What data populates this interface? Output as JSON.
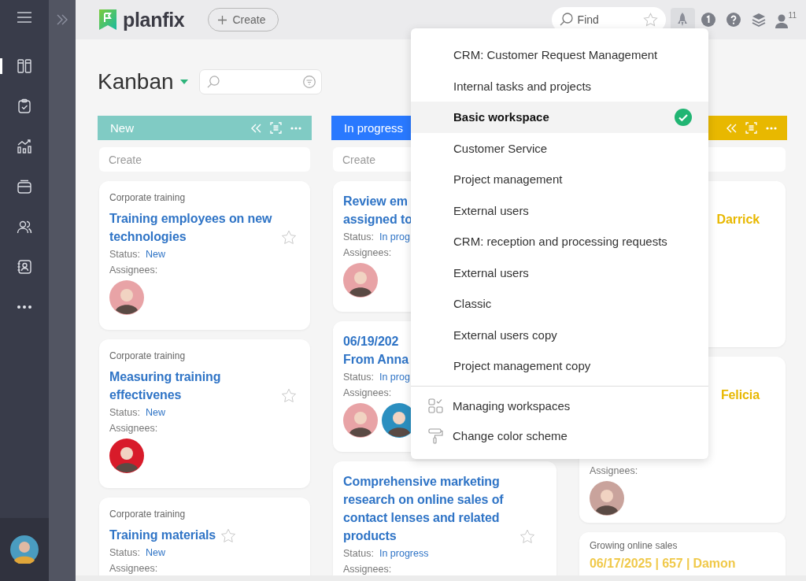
{
  "nav": [
    {
      "kind": "boards",
      "selected": true
    },
    {
      "kind": "tasks",
      "selected": false
    },
    {
      "kind": "reports",
      "selected": false
    },
    {
      "kind": "inbox",
      "selected": false
    },
    {
      "kind": "people",
      "selected": false
    },
    {
      "kind": "contact",
      "selected": false
    },
    {
      "kind": "more",
      "selected": false
    }
  ],
  "top_bar": {
    "logo": "planfix",
    "create": "Create",
    "search": {
      "placeholder": "Find"
    },
    "users_count": "11"
  },
  "page": {
    "title": "Kanban"
  },
  "columns": [
    {
      "title": "New",
      "color": "#80cbc4",
      "tools": true,
      "create_placeholder": "Create",
      "cards": [
        {
          "project": "Corporate training",
          "title": "Training employees on new technologies",
          "color": "#2f74c6",
          "favorite": false,
          "status_label": "Status:",
          "status": "New",
          "assignees_label": "Assignees:",
          "assignees": [
            {
              "color": "#e8a3a6"
            }
          ]
        },
        {
          "project": "Corporate training",
          "title": "Measuring training effectivenes",
          "color": "#2f74c6",
          "favorite": false,
          "status_label": "Status:",
          "status": "New",
          "assignees_label": "Assignees:",
          "assignees": [
            {
              "color": "#d81b2a"
            }
          ]
        },
        {
          "project": "Corporate training",
          "title": "Training materials",
          "color": "#2f74c6",
          "favorite": false,
          "status_label": "Status:",
          "status": "New",
          "assignees_label": "Assignees:"
        }
      ]
    },
    {
      "title": "In progress",
      "color": "#2979ff",
      "create_placeholder": "Create",
      "cards": [
        {
          "title": "Review em\nassigned to",
          "color": "#2f74c6",
          "status_label": "Status:",
          "status": "In prog",
          "assignees_label": "Assignees:",
          "assignees": [
            {
              "color": "#e8a3a6"
            }
          ]
        },
        {
          "title": "06/19/202\nFrom Anna",
          "color": "#2f74c6",
          "status_label": "Status:",
          "status": "In prog",
          "assignees_label": "Assignees:",
          "assignees": [
            {
              "color": "#e8a3a6"
            },
            {
              "color": "#2b8fc0"
            }
          ]
        },
        {
          "title": "Comprehensive marketing research on online sales of contact lenses and related products",
          "color": "#2f74c6",
          "favorite": false,
          "status_label": "Status:",
          "status": "In progress",
          "assignees_label": "Assignees:"
        }
      ]
    },
    {
      "color": "#e8b800",
      "tools": true,
      "cards": [
        {
          "title": "Darrick",
          "color": "#e8b800"
        },
        {
          "title": "Felicia",
          "color": "#e8b800",
          "assignees_label": "Assignees:",
          "assignees": [
            {
              "color": "#c9a39c"
            }
          ]
        },
        {
          "project": "Growing online sales",
          "title": "06/17/2025 | 657 | Damon",
          "color": "#f0c94a"
        }
      ]
    }
  ],
  "workspace_menu": {
    "items": [
      {
        "label": "CRM: Customer Request Management",
        "selected": false
      },
      {
        "label": "Internal tasks and projects",
        "selected": false
      },
      {
        "label": "Basic workspace",
        "selected": true
      },
      {
        "label": "Customer Service",
        "selected": false
      },
      {
        "label": "Project management",
        "selected": false
      },
      {
        "label": "External users",
        "selected": false
      },
      {
        "label": "CRM: reception and processing requests",
        "selected": false
      },
      {
        "label": "External users",
        "selected": false
      },
      {
        "label": "Classic",
        "selected": false
      },
      {
        "label": "External users copy",
        "selected": false
      },
      {
        "label": "Project management copy",
        "selected": false
      }
    ],
    "actions": [
      {
        "kind": "workspaces",
        "label": "Managing workspaces"
      },
      {
        "kind": "paint",
        "label": "Change color scheme"
      }
    ]
  }
}
